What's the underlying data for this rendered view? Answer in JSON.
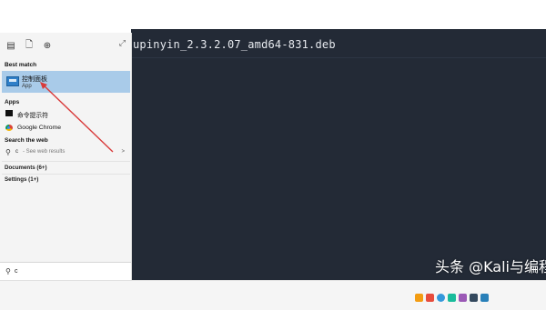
{
  "terminal": {
    "command_line": "upinyin_2.3.2.07_amd64-831.deb"
  },
  "start_menu": {
    "top_icons": [
      "document-list-icon",
      "file-icon",
      "globe-icon"
    ],
    "close_glyph": "⤢",
    "best_match": {
      "heading": "Best match",
      "title": "控制面板",
      "subtitle": "App"
    },
    "apps": {
      "heading": "Apps",
      "items": [
        {
          "label": "命令提示符",
          "icon": "cmd-icon"
        },
        {
          "label": "Google Chrome",
          "icon": "chrome-icon"
        }
      ]
    },
    "search_web": {
      "heading": "Search the web",
      "query": "c",
      "suffix": "- See web results",
      "arrow": ">"
    },
    "documents_label": "Documents (6+)",
    "settings_label": "Settings (1+)"
  },
  "search_box": {
    "value": "c"
  },
  "watermark": "头条 @Kali与编程",
  "colors": {
    "terminal_bg": "#232a36",
    "highlight": "#a9cbe9",
    "annotation": "#d93a3a"
  }
}
